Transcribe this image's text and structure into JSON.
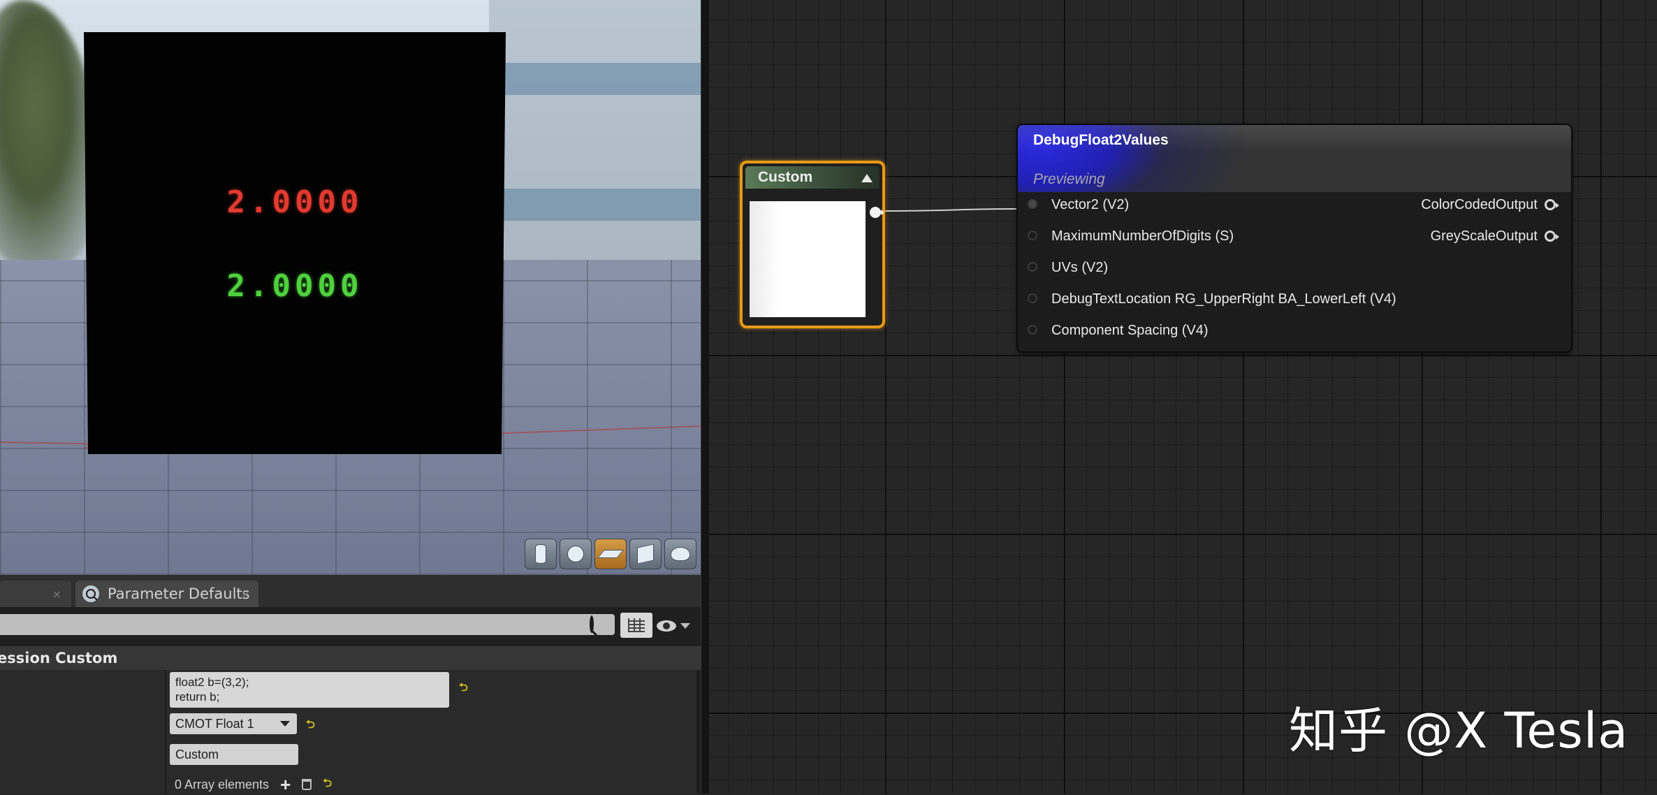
{
  "viewport": {
    "readout_red": "2.0000",
    "readout_green": "2.0000",
    "view_buttons": [
      {
        "name": "cylinder-preview-button",
        "icon": "cylinder-icon",
        "active": false
      },
      {
        "name": "sphere-preview-button",
        "icon": "sphere-icon",
        "active": false
      },
      {
        "name": "plane-preview-button",
        "icon": "plane-icon",
        "active": true
      },
      {
        "name": "cube-preview-button",
        "icon": "cube-icon",
        "active": false
      },
      {
        "name": "teapot-preview-button",
        "icon": "teapot-icon",
        "active": false
      }
    ]
  },
  "panel": {
    "tabs": [
      {
        "label": "",
        "close": "×"
      },
      {
        "label": "Parameter Defaults",
        "icon": "search-icon",
        "close": "×"
      }
    ],
    "search": {
      "value": "",
      "placeholder": ""
    },
    "section_title": "ession Custom",
    "code_lines": [
      "float2 b=(3,2);",
      "return b;"
    ],
    "output_type": "CMOT Float 1",
    "description": "Custom",
    "array_label": "0 Array elements",
    "reset_symbol": "⮌"
  },
  "graph": {
    "custom_node": {
      "title": "Custom"
    },
    "debug_node": {
      "title": "DebugFloat2Values",
      "status": "Previewing",
      "inputs": [
        "Vector2 (V2)",
        "MaximumNumberOfDigits (S)",
        "UVs (V2)",
        "DebugTextLocation RG_UpperRight BA_LowerLeft (V4)",
        "Component Spacing (V4)"
      ],
      "outputs": [
        "ColorCodedOutput",
        "GreyScaleOutput"
      ]
    }
  },
  "watermark": "知乎 @X Tesla",
  "colors": {
    "node_selected": "#e69a16",
    "readout_red": "#e23a2f",
    "readout_green": "#4fd13e",
    "function_header": "#2a2ae0",
    "custom_header": "#5a7a58",
    "reset_arrow": "#d8c21a"
  }
}
